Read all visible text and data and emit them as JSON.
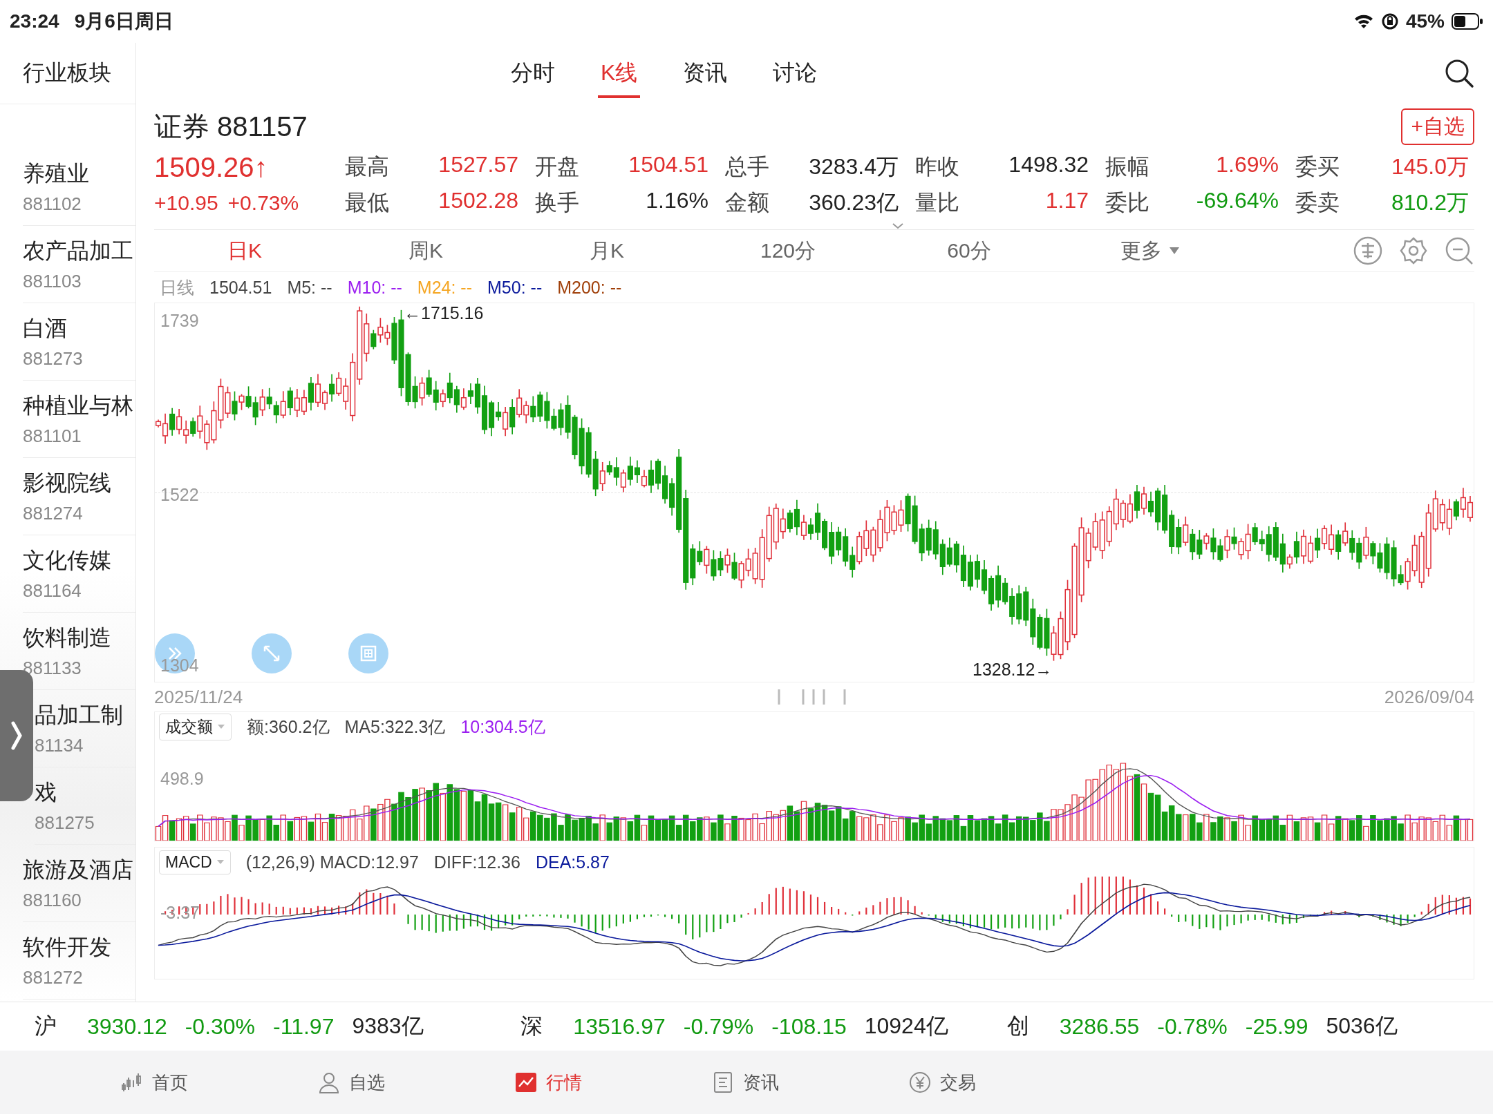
{
  "status_bar": {
    "time": "23:24",
    "date": "9月6日周日",
    "battery": "45%"
  },
  "sidebar": {
    "title": "行业板块",
    "items": [
      {
        "name": "养殖业",
        "code": "881102"
      },
      {
        "name": "农产品加工",
        "code": "881103"
      },
      {
        "name": "白酒",
        "code": "881273"
      },
      {
        "name": "种植业与林",
        "code": "881101"
      },
      {
        "name": "影视院线",
        "code": "881274"
      },
      {
        "name": "文化传媒",
        "code": "881164"
      },
      {
        "name": "饮料制造",
        "code": "881133"
      },
      {
        "name": "品加工制",
        "code": "81134"
      },
      {
        "name": "戏",
        "code": "881275"
      },
      {
        "name": "旅游及酒店",
        "code": "881160"
      },
      {
        "name": "软件开发",
        "code": "881272"
      }
    ]
  },
  "tabs": [
    {
      "label": "分时",
      "selected": false
    },
    {
      "label": "K线",
      "selected": true
    },
    {
      "label": "资讯",
      "selected": false
    },
    {
      "label": "讨论",
      "selected": false
    }
  ],
  "stock": {
    "name": "证券",
    "code": "881157",
    "watch_button": "+自选",
    "price": "1509.26↑",
    "change": "+10.95",
    "change_pct": "+0.73%",
    "color": "#e0302f"
  },
  "quote_rows": [
    {
      "cells": [
        {
          "label": "最高",
          "value": "1527.57",
          "color": "#e0302f"
        },
        {
          "label": "开盘",
          "value": "1504.51",
          "color": "#e0302f"
        },
        {
          "label": "总手",
          "value": "3283.4万",
          "color": "#222222"
        },
        {
          "label": "昨收",
          "value": "1498.32",
          "color": "#222222"
        },
        {
          "label": "振幅",
          "value": "1.69%",
          "color": "#e0302f"
        },
        {
          "label": "委买",
          "value": "145.0万",
          "color": "#e0302f"
        }
      ]
    },
    {
      "cells": [
        {
          "label": "最低",
          "value": "1502.28",
          "color": "#e0302f"
        },
        {
          "label": "换手",
          "value": "1.16%",
          "color": "#222222"
        },
        {
          "label": "金额",
          "value": "360.23亿",
          "color": "#222222",
          "dropdown": true
        },
        {
          "label": "量比",
          "value": "1.17",
          "color": "#e0302f"
        },
        {
          "label": "委比",
          "value": "-69.64%",
          "color": "#119a11"
        },
        {
          "label": "委卖",
          "value": "810.2万",
          "color": "#119a11"
        }
      ]
    }
  ],
  "periods": [
    {
      "label": "日K",
      "selected": true
    },
    {
      "label": "周K",
      "selected": false
    },
    {
      "label": "月K",
      "selected": false
    },
    {
      "label": "120分",
      "selected": false
    },
    {
      "label": "60分",
      "selected": false
    },
    {
      "label": "更多",
      "selected": false,
      "kind": "menu"
    }
  ],
  "ma_legend": [
    {
      "text": "日线",
      "color": "#999999"
    },
    {
      "text": "1504.51",
      "color": "#444444"
    },
    {
      "text": "M5: --",
      "color": "#444444"
    },
    {
      "text": "M10: --",
      "color": "#9b1ff0"
    },
    {
      "text": "M24: --",
      "color": "#f5a623"
    },
    {
      "text": "M50: --",
      "color": "#0b1a9c"
    },
    {
      "text": "M200: --",
      "color": "#a0400a"
    }
  ],
  "price_chart": {
    "y_labels": [
      "1739",
      "1522",
      "1304"
    ],
    "high_note": "←1715.16",
    "low_note": "1328.12→"
  },
  "dates": {
    "start": "2025/11/24",
    "end": "2026/09/04"
  },
  "volume": {
    "selector": "成交额",
    "y_label": "498.9",
    "legend": [
      {
        "text": "额:360.2亿",
        "color": "#444444"
      },
      {
        "text": "MA5:322.3亿",
        "color": "#444444"
      },
      {
        "text": "10:304.5亿",
        "color": "#9b1ff0"
      }
    ]
  },
  "macd": {
    "selector": "MACD",
    "y_label": "-3.37",
    "legend": [
      {
        "text": "(12,26,9) MACD:12.97",
        "color": "#444444"
      },
      {
        "text": "DIFF:12.36",
        "color": "#444444"
      },
      {
        "text": "DEA:5.87",
        "color": "#0b1a9c"
      }
    ]
  },
  "indices": [
    {
      "name": "沪",
      "price": "3930.12",
      "pct": "-0.30%",
      "change": "-11.97",
      "amount": "9383亿",
      "color": "#119a11"
    },
    {
      "name": "深",
      "price": "13516.97",
      "pct": "-0.79%",
      "change": "-108.15",
      "amount": "10924亿",
      "color": "#119a11"
    },
    {
      "name": "创",
      "price": "3286.55",
      "pct": "-0.78%",
      "change": "-25.99",
      "amount": "5036亿",
      "color": "#119a11"
    }
  ],
  "bottom_tabs": [
    {
      "label": "首页",
      "kind": "candles",
      "selected": false
    },
    {
      "label": "自选",
      "kind": "person",
      "selected": false
    },
    {
      "label": "行情",
      "kind": "chart",
      "selected": true
    },
    {
      "label": "资讯",
      "kind": "document",
      "selected": false
    },
    {
      "label": "交易",
      "kind": "yen",
      "selected": false
    }
  ]
}
